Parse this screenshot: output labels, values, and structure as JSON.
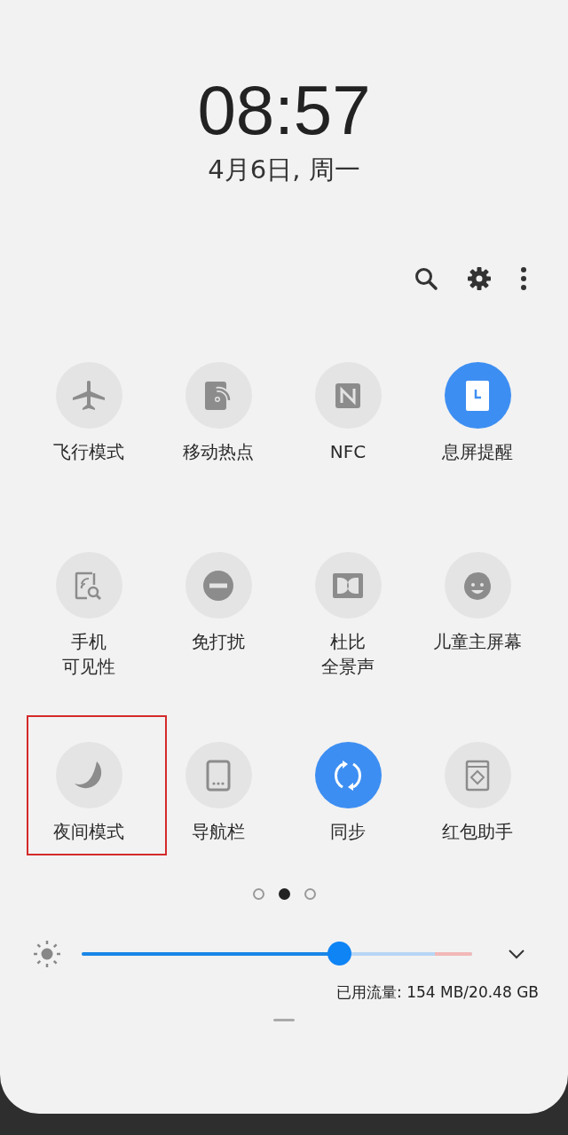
{
  "clock": {
    "time": "08:57",
    "date": "4月6日, 周一"
  },
  "tiles": [
    {
      "kind": "airplane",
      "lines": [
        "飞行模式"
      ],
      "on": false,
      "highlighted": false
    },
    {
      "kind": "hotspot",
      "lines": [
        "移动热点"
      ],
      "on": false,
      "highlighted": false
    },
    {
      "kind": "nfc",
      "lines": [
        "NFC"
      ],
      "on": false,
      "highlighted": false
    },
    {
      "kind": "aod",
      "lines": [
        "息屏提醒"
      ],
      "on": true,
      "highlighted": false
    },
    {
      "kind": "visibility",
      "lines": [
        "手机",
        "可见性"
      ],
      "on": false,
      "highlighted": false
    },
    {
      "kind": "dnd",
      "lines": [
        "免打扰"
      ],
      "on": false,
      "highlighted": false
    },
    {
      "kind": "dolby",
      "lines": [
        "杜比",
        "全景声"
      ],
      "on": false,
      "highlighted": false
    },
    {
      "kind": "kids",
      "lines": [
        "儿童主屏幕"
      ],
      "on": false,
      "highlighted": false
    },
    {
      "kind": "moon",
      "lines": [
        "夜间模式"
      ],
      "on": false,
      "highlighted": true
    },
    {
      "kind": "navbar",
      "lines": [
        "导航栏"
      ],
      "on": false,
      "highlighted": false
    },
    {
      "kind": "sync",
      "lines": [
        "同步"
      ],
      "on": true,
      "highlighted": false
    },
    {
      "kind": "envelope",
      "lines": [
        "红包助手"
      ],
      "on": false,
      "highlighted": false
    }
  ],
  "pages": [
    {
      "selected": false
    },
    {
      "selected": true
    },
    {
      "selected": false
    }
  ],
  "brightness": {
    "level": 0.66
  },
  "data_usage": "已用流量: 154 MB/20.48 GB"
}
